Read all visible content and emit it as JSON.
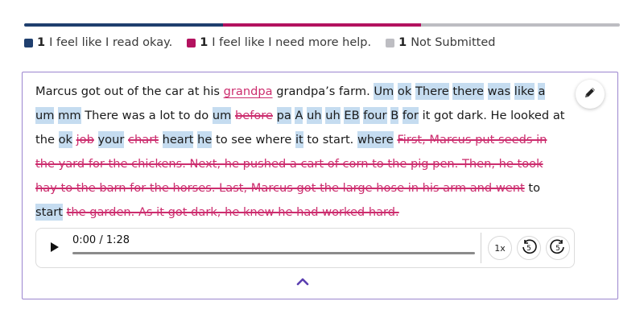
{
  "colors": {
    "read_okay": "#1f3f6e",
    "need_help": "#b3125f",
    "not_submitted": "#bdbdc2",
    "highlight": "#c5dcf0",
    "error": "#cc2d6e",
    "card_border": "#9b85cf",
    "chevron": "#5b3fb0"
  },
  "progress": [
    {
      "key": "read_okay",
      "count": 1,
      "fraction": 0.3333
    },
    {
      "key": "need_help",
      "count": 1,
      "fraction": 0.3333
    },
    {
      "key": "not_submitted",
      "count": 1,
      "fraction": 0.3334
    }
  ],
  "legend": [
    {
      "count": "1",
      "label": "I feel like I read okay."
    },
    {
      "count": "1",
      "label": "I feel like I need more help."
    },
    {
      "count": "1",
      "label": "Not Submitted"
    }
  ],
  "passage": {
    "tokens": [
      {
        "t": "Marcus",
        "s": "n"
      },
      {
        "t": "got",
        "s": "n"
      },
      {
        "t": "out",
        "s": "n"
      },
      {
        "t": "of",
        "s": "n"
      },
      {
        "t": "the",
        "s": "n"
      },
      {
        "t": "car",
        "s": "n"
      },
      {
        "t": "at",
        "s": "n"
      },
      {
        "t": "his",
        "s": "n"
      },
      {
        "t": "grandpa",
        "s": "ins"
      },
      {
        "t": "grandpa’s",
        "s": "n"
      },
      {
        "t": "farm.",
        "s": "n"
      },
      {
        "t": "Um",
        "s": "hl"
      },
      {
        "t": "ok",
        "s": "hl"
      },
      {
        "t": "There",
        "s": "hl"
      },
      {
        "t": "there",
        "s": "hl"
      },
      {
        "t": "was",
        "s": "hl"
      },
      {
        "t": "like",
        "s": "hl"
      },
      {
        "t": "a",
        "s": "hl"
      },
      {
        "t": "um",
        "s": "hl"
      },
      {
        "t": "mm",
        "s": "hl"
      },
      {
        "t": "There",
        "s": "n"
      },
      {
        "t": "was",
        "s": "n"
      },
      {
        "t": "a",
        "s": "n"
      },
      {
        "t": "lot",
        "s": "n"
      },
      {
        "t": "to",
        "s": "n"
      },
      {
        "t": "do",
        "s": "n"
      },
      {
        "t": "um",
        "s": "hl"
      },
      {
        "t": "before",
        "s": "del"
      },
      {
        "t": "pa",
        "s": "hl"
      },
      {
        "t": "A",
        "s": "hl"
      },
      {
        "t": "uh",
        "s": "hl"
      },
      {
        "t": "uh",
        "s": "hl"
      },
      {
        "t": "EB",
        "s": "hl"
      },
      {
        "t": "four",
        "s": "hl"
      },
      {
        "t": "B",
        "s": "hl"
      },
      {
        "t": "for",
        "s": "hl"
      },
      {
        "t": "it",
        "s": "n"
      },
      {
        "t": "got",
        "s": "n"
      },
      {
        "t": "dark.",
        "s": "n"
      },
      {
        "t": "He",
        "s": "n"
      },
      {
        "t": "looked",
        "s": "n"
      },
      {
        "t": "at",
        "s": "n"
      },
      {
        "t": "the",
        "s": "n"
      },
      {
        "t": "ok",
        "s": "hl"
      },
      {
        "t": "job",
        "s": "del"
      },
      {
        "t": "your",
        "s": "hl"
      },
      {
        "t": "chart",
        "s": "del"
      },
      {
        "t": "heart",
        "s": "hl"
      },
      {
        "t": "he",
        "s": "hl"
      },
      {
        "t": "to",
        "s": "n"
      },
      {
        "t": "see",
        "s": "n"
      },
      {
        "t": "where",
        "s": "n"
      },
      {
        "t": "it",
        "s": "hl"
      },
      {
        "t": "to",
        "s": "n"
      },
      {
        "t": "start.",
        "s": "n"
      },
      {
        "t": "where",
        "s": "hl"
      },
      {
        "t": "First, Marcus put seeds in the yard for the chickens. Next, he pushed a cart of corn to the pig pen. Then, he took hay to the barn for the horses. Last, Marcus got the large hose in his arm and went",
        "s": "del"
      },
      {
        "t": "to",
        "s": "n"
      },
      {
        "t": "start",
        "s": "hl"
      },
      {
        "t": "the garden. As it got dark, he knew he had worked hard.",
        "s": "del"
      }
    ]
  },
  "player": {
    "time": "0:00 / 1:28",
    "progress": 0,
    "speed": "1x",
    "rewind_seconds": "5",
    "forward_seconds": "5"
  },
  "icons": {
    "edit": "pencil-icon",
    "play": "play-icon",
    "rewind": "rewind-5-icon",
    "forward": "forward-5-icon",
    "collapse": "chevron-up-icon"
  }
}
